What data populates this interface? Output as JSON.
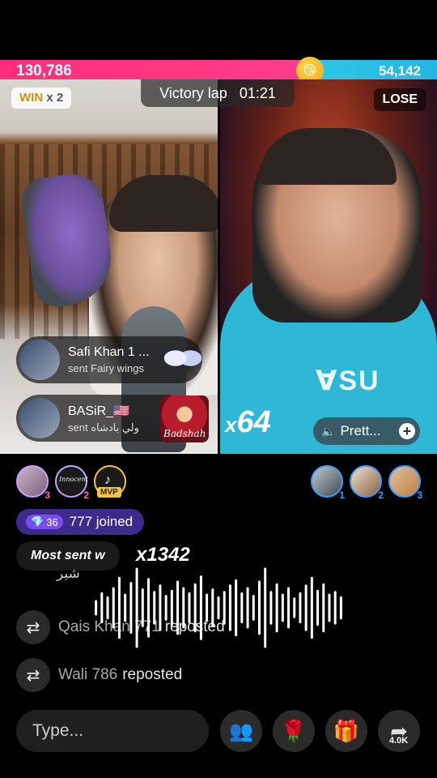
{
  "battle": {
    "score_left": "130,786",
    "score_right": "54,142",
    "timer_label": "Victory lap",
    "timer_value": "01:21",
    "win_label": "WIN",
    "win_multiplier": "x 2",
    "lose_label": "LOSE"
  },
  "gifts": [
    {
      "name": "Safi Khan 1 ...",
      "action": "sent Fairy wings"
    },
    {
      "name": "BASiR_🇺🇸",
      "action": "sent ولي بادشاه"
    }
  ],
  "gift_image_text": "Badshah",
  "combo_multiplier": "64",
  "song": {
    "label": "Prett..."
  },
  "viewers_left": [
    {
      "rank": "3"
    },
    {
      "rank": "2",
      "label": "Innocent"
    },
    {
      "rank": "",
      "badge": "MVP"
    }
  ],
  "viewers_right": [
    {
      "rank": "1"
    },
    {
      "rank": "2"
    },
    {
      "rank": "3"
    }
  ],
  "joined": {
    "gem_count": "36",
    "text": "777 joined"
  },
  "most_sent": {
    "label": "Most sent w",
    "count": "x1342"
  },
  "partial_comment": "شير",
  "reposts": [
    {
      "user": "Qais Khan 771",
      "action": "reposted"
    },
    {
      "user": "Wali 786",
      "action": "reposted"
    }
  ],
  "input": {
    "placeholder": "Type..."
  },
  "share_count": "4.0K",
  "colors": {
    "left_team": "#ff2e7a",
    "right_team": "#2ec7e6",
    "joined_bg": "#3c2a8c"
  }
}
